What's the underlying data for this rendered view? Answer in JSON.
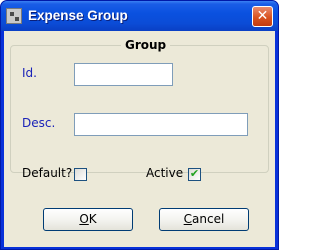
{
  "window": {
    "title": "Expense Group",
    "icon": "app-icon",
    "close_symbol": "✕"
  },
  "group": {
    "title": "Group"
  },
  "fields": {
    "id": {
      "label": "Id.",
      "value": ""
    },
    "desc": {
      "label": "Desc.",
      "value": ""
    }
  },
  "checkboxes": {
    "default": {
      "label": "Default?",
      "checked": false
    },
    "active": {
      "label": "Active",
      "checked": true,
      "mark": "✔"
    }
  },
  "buttons": {
    "ok": {
      "mnemonic": "O",
      "rest": "K"
    },
    "cancel": {
      "mnemonic": "C",
      "rest": "ancel"
    }
  },
  "colors": {
    "titlebar": "#0a51e0",
    "client_bg": "#ece9d8",
    "label_blue": "#1a22b8",
    "close_red": "#d9531f",
    "check_green": "#21a121"
  }
}
